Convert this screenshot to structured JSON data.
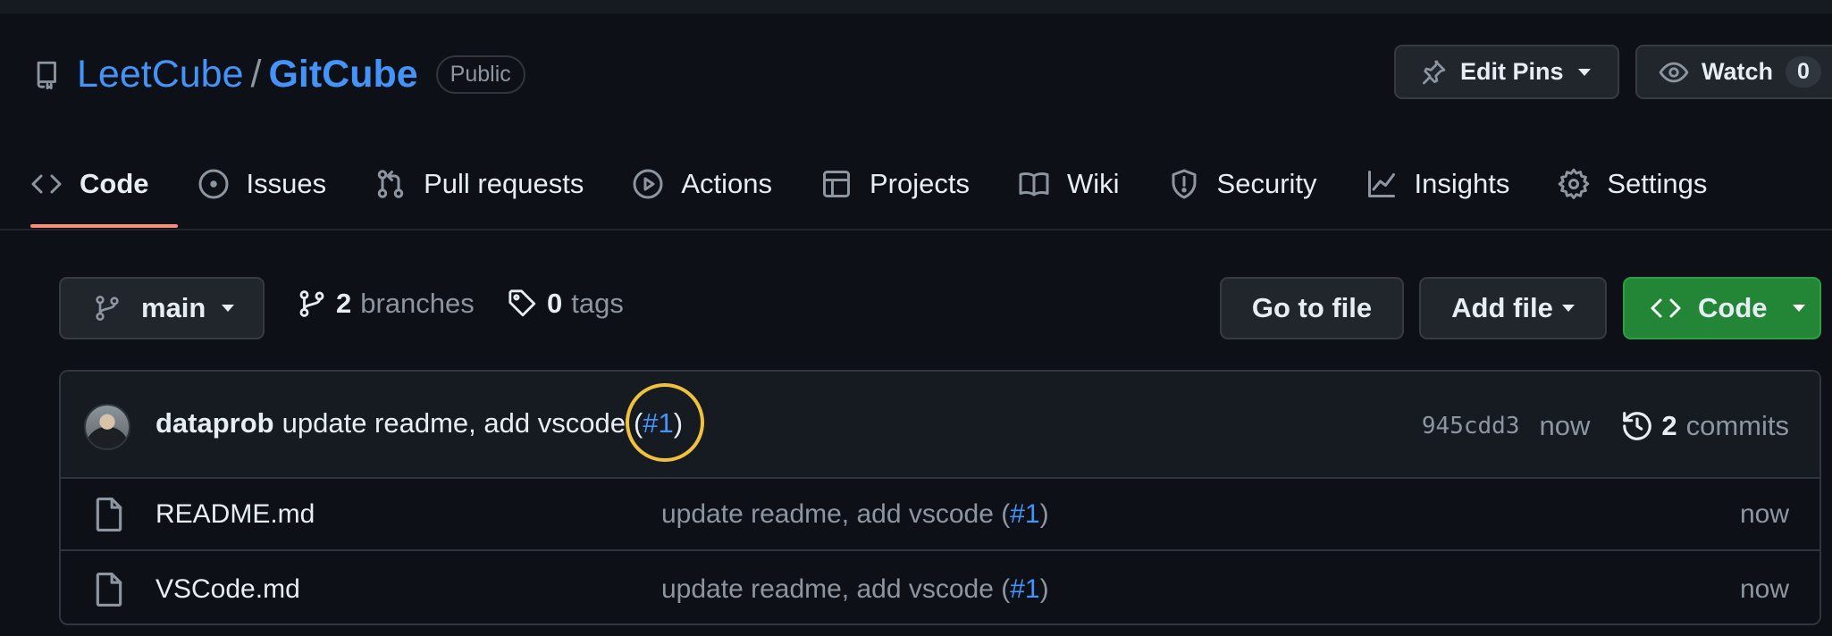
{
  "repo": {
    "owner": "LeetCube",
    "separator": "/",
    "name": "GitCube",
    "visibility": "Public"
  },
  "header_buttons": {
    "pins_label": "Edit Pins",
    "watch_label": "Watch",
    "watch_count": "0"
  },
  "tabs": [
    {
      "label": "Code",
      "icon": "code-icon",
      "active": true
    },
    {
      "label": "Issues",
      "icon": "issue-opened-icon"
    },
    {
      "label": "Pull requests",
      "icon": "git-pull-request-icon"
    },
    {
      "label": "Actions",
      "icon": "play-icon"
    },
    {
      "label": "Projects",
      "icon": "table-icon"
    },
    {
      "label": "Wiki",
      "icon": "book-icon"
    },
    {
      "label": "Security",
      "icon": "shield-icon"
    },
    {
      "label": "Insights",
      "icon": "graph-icon"
    },
    {
      "label": "Settings",
      "icon": "gear-icon"
    }
  ],
  "toolbar": {
    "branch": "main",
    "branches_count": "2",
    "branches_label": "branches",
    "tags_count": "0",
    "tags_label": "tags",
    "go_to_file": "Go to file",
    "add_file": "Add file",
    "code": "Code"
  },
  "latest_commit": {
    "author": "dataprob",
    "message": "update readme, add vscode",
    "open_paren": "(",
    "pr": "#1",
    "close_paren": ")",
    "sha": "945cdd3",
    "when": "now",
    "commits_count": "2",
    "commits_label": "commits"
  },
  "files": [
    {
      "name": "README.md",
      "message": "update readme, add vscode (",
      "pr": "#1",
      "close": ")",
      "when": "now"
    },
    {
      "name": "VSCode.md",
      "message": "update readme, add vscode (",
      "pr": "#1",
      "close": ")",
      "when": "now"
    }
  ],
  "colors": {
    "background": "#0d1117",
    "link": "#4493f8",
    "active_tab_underline": "#fd8c73",
    "code_button": "#238636",
    "highlight_ring": "#f0c040"
  }
}
